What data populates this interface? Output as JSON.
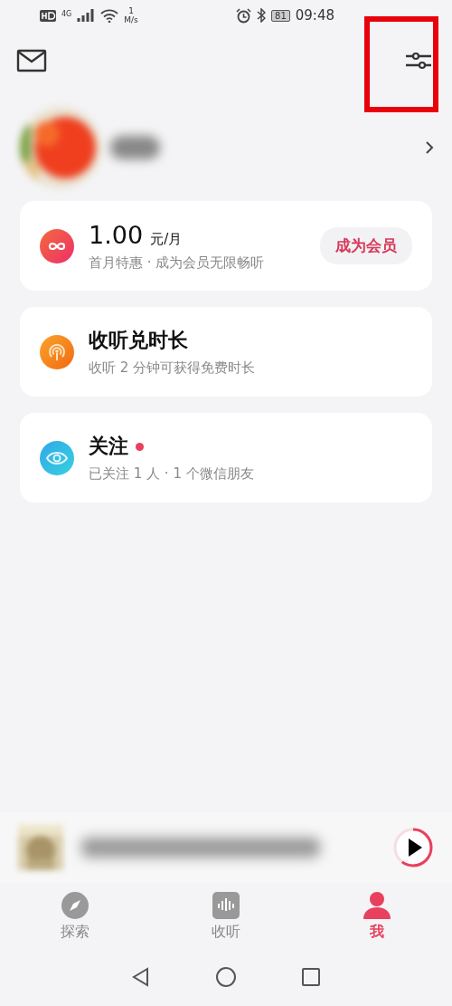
{
  "status_bar": {
    "network": "4G",
    "speed_value": "1",
    "speed_unit": "M/s",
    "battery": "81",
    "time": "09:48"
  },
  "top_bar": {
    "settings": {
      "highlighted": true
    }
  },
  "cards": [
    {
      "kind": "vip",
      "price": "1.00",
      "unit": "元/月",
      "subtitle": "首月特惠 · 成为会员无限畅听",
      "button": "成为会员",
      "dot": false
    },
    {
      "kind": "listen",
      "title": "收听兑时长",
      "subtitle": "收听 2 分钟可获得免费时长",
      "dot": false
    },
    {
      "kind": "follow",
      "title": "关注",
      "subtitle": "已关注 1 人 · 1 个微信朋友",
      "dot": true
    }
  ],
  "tabs": [
    {
      "kind": "explore",
      "label": "探索",
      "selected": false
    },
    {
      "kind": "listen",
      "label": "收听",
      "selected": false
    },
    {
      "kind": "me",
      "label": "我",
      "selected": true
    }
  ]
}
